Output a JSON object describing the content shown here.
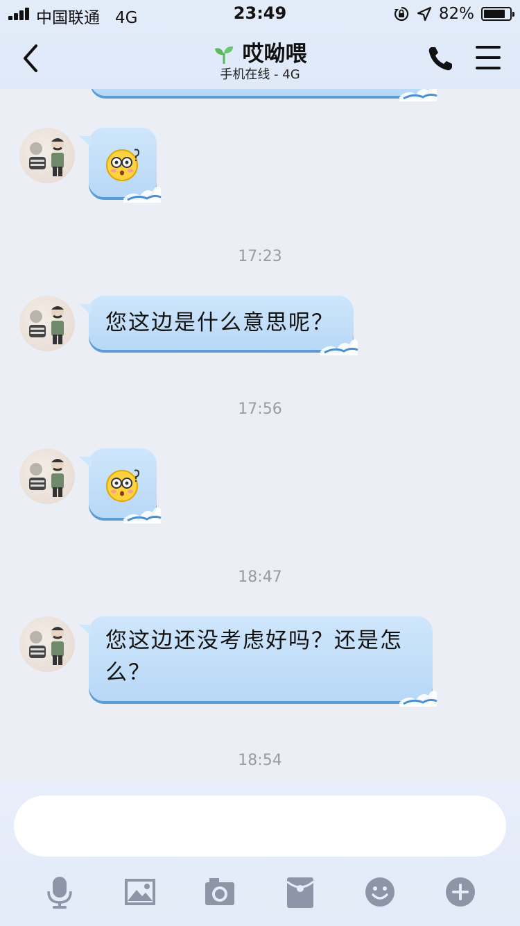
{
  "status_bar": {
    "carrier": "中国联通",
    "network": "4G",
    "time": "23:49",
    "battery_percent": "82%",
    "battery_level": 0.82,
    "icons": [
      "signal-icon",
      "orientation-lock-icon",
      "location-arrow-icon",
      "battery-icon"
    ]
  },
  "header": {
    "title": "哎呦喂",
    "subtitle": "手机在线 - 4G",
    "icons": [
      "back-icon",
      "sprout-icon",
      "phone-icon",
      "menu-icon"
    ]
  },
  "messages": [
    {
      "type": "emoji",
      "emoji": "surprised-face-icon"
    },
    {
      "type": "timestamp",
      "text": "17:23"
    },
    {
      "type": "text",
      "text": "您这边是什么意思呢？"
    },
    {
      "type": "timestamp",
      "text": "17:56"
    },
    {
      "type": "emoji",
      "emoji": "surprised-face-icon"
    },
    {
      "type": "timestamp",
      "text": "18:47"
    },
    {
      "type": "text",
      "text": "您这边还没考虑好吗？还是怎么？"
    },
    {
      "type": "timestamp",
      "text": "18:54"
    }
  ],
  "input": {
    "value": "",
    "placeholder": ""
  },
  "toolbar": [
    "microphone-icon",
    "image-icon",
    "camera-icon",
    "red-packet-icon",
    "emoji-icon",
    "plus-icon"
  ],
  "colors": {
    "bubble_top": "#cfe6fb",
    "bubble_bottom": "#b8d8f7",
    "bubble_edge": "#5b9bd6",
    "background": "#eceef5",
    "tool_icon": "#8d95a6",
    "sprout": "#5cb85c"
  }
}
